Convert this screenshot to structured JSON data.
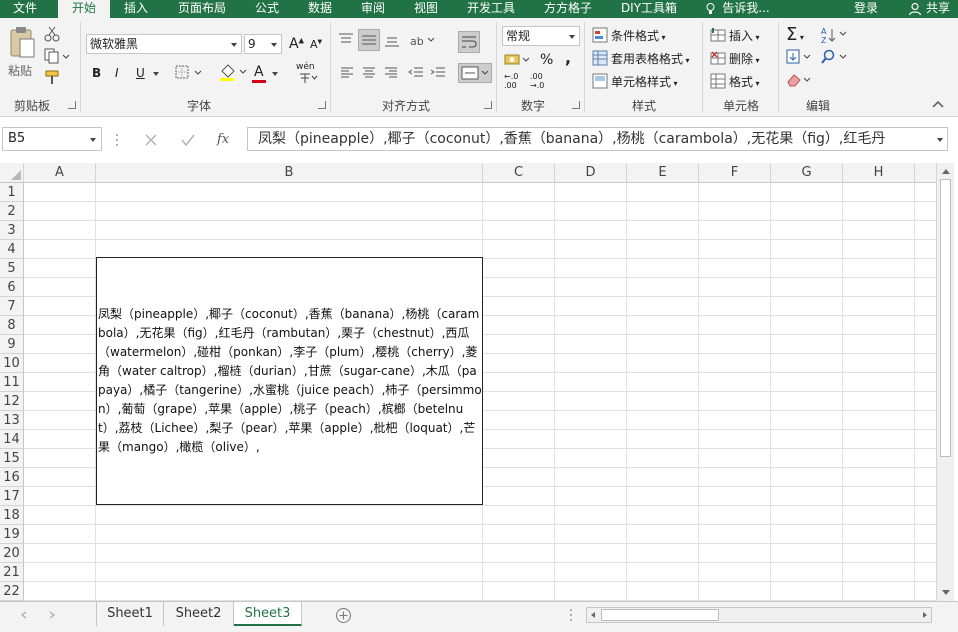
{
  "ribbon_tabs": [
    "文件",
    "开始",
    "插入",
    "页面布局",
    "公式",
    "数据",
    "审阅",
    "视图",
    "开发工具",
    "方方格子",
    "DIY工具箱",
    "告诉我..."
  ],
  "active_tab": "开始",
  "login_label": "登录",
  "share_label": "共享",
  "clipboard": {
    "paste_label": "粘贴",
    "group_label": "剪贴板"
  },
  "font": {
    "name": "微软雅黑",
    "size": "9",
    "bold": "B",
    "italic": "I",
    "underline": "U",
    "grow": "A",
    "shrink": "A",
    "font_color_letter": "A",
    "phonetic": "wén",
    "group_label": "字体"
  },
  "alignment": {
    "group_label": "对齐方式"
  },
  "number": {
    "format": "常规",
    "percent": "%",
    "comma": ",",
    "inc_decimal_top": "←.0",
    "inc_decimal_bottom": ".00",
    "dec_decimal_top": ".00",
    "dec_decimal_bottom": "→.0",
    "group_label": "数字"
  },
  "styles": {
    "conditional": "条件格式",
    "table": "套用表格格式",
    "cell": "单元格样式",
    "group_label": "样式"
  },
  "cells": {
    "insert": "插入",
    "delete": "删除",
    "format": "格式",
    "group_label": "单元格"
  },
  "editing": {
    "group_label": "编辑"
  },
  "formula_bar": {
    "name_box": "B5",
    "fx": "fx",
    "content": "凤梨（pineapple）,椰子（coconut）,香蕉（banana）,杨桃（carambola）,无花果（fig）,红毛丹"
  },
  "columns": [
    "A",
    "B",
    "C",
    "D",
    "E",
    "F",
    "G",
    "H"
  ],
  "rows": [
    "1",
    "2",
    "3",
    "4",
    "5",
    "6",
    "7",
    "8",
    "9",
    "10",
    "11",
    "12",
    "13",
    "14",
    "15",
    "16",
    "17",
    "18",
    "19",
    "20",
    "21",
    "22"
  ],
  "cell_b5": "凤梨（pineapple）,椰子（coconut）,香蕉（banana）,杨桃（carambola）,无花果（fig）,红毛丹（rambutan）,栗子（chestnut）,西瓜（watermelon）,碰柑（ponkan）,李子（plum）,樱桃（cherry）,菱角（water caltrop）,榴梿（durian）,甘蔗（sugar-cane）,木瓜（papaya）,橘子（tangerine）,水蜜桃（juice peach）,柿子（persimmon）,葡萄（grape）,苹果（apple）,桃子（peach）,槟榔（betelnut）,荔枝（Lichee）,梨子（pear）,苹果（apple）,枇杷（loquat）,芒果（mango）,橄榄（olive）,",
  "sheets": [
    "Sheet1",
    "Sheet2",
    "Sheet3"
  ],
  "active_sheet": "Sheet3",
  "colors": {
    "accent": "#217346",
    "ribbon_bg": "#f3f3f3",
    "font_color_bar": "#d0021b",
    "fill_bar": "#ffff00"
  }
}
